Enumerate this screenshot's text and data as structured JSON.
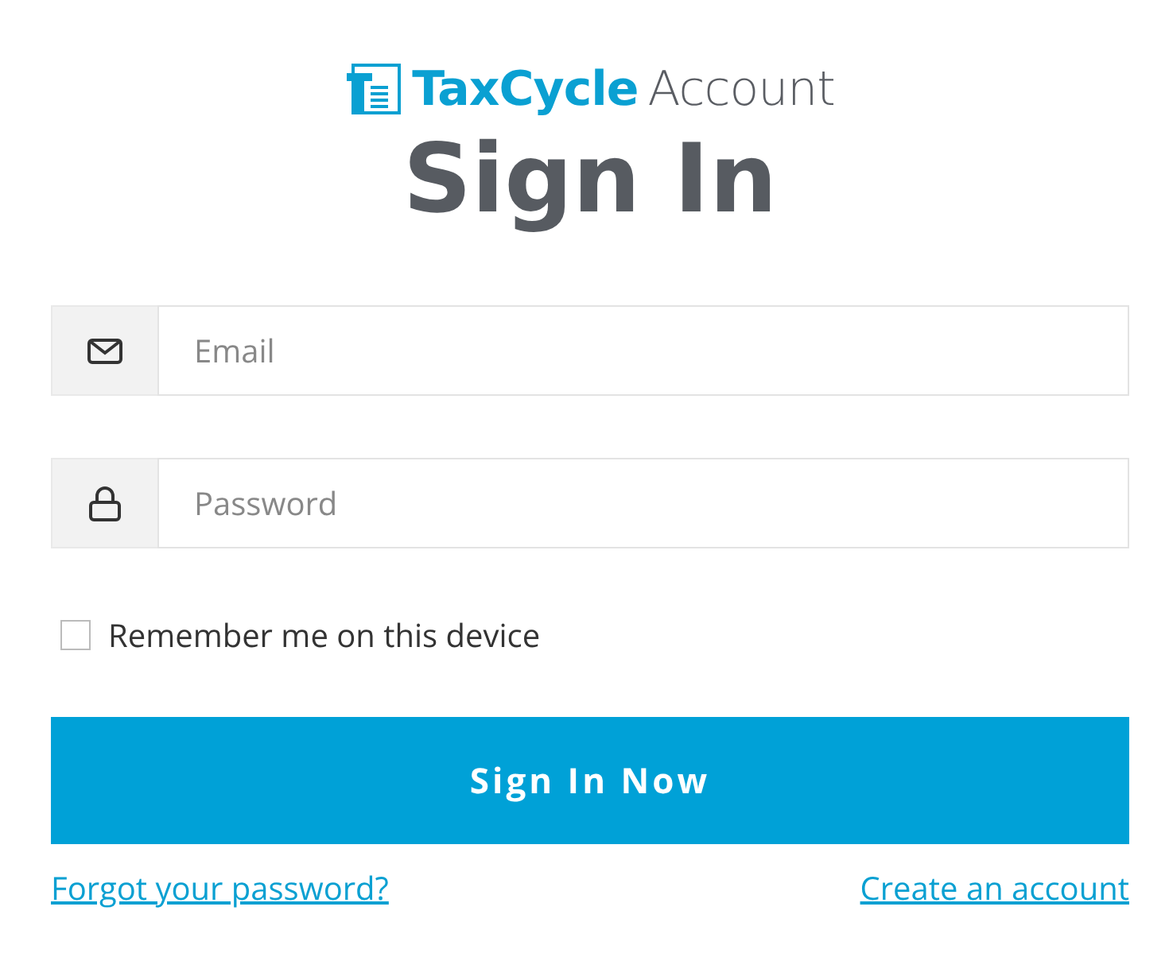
{
  "brand": {
    "name": "TaxCycle",
    "suffix": "Account"
  },
  "title": "Sign In",
  "fields": [
    {
      "kind": "email",
      "placeholder": "Email"
    },
    {
      "kind": "password",
      "placeholder": "Password"
    }
  ],
  "remember": {
    "label": "Remember me on this device",
    "checked": false
  },
  "submit": "Sign In Now",
  "links": [
    "Forgot your password?",
    "Create an account"
  ]
}
